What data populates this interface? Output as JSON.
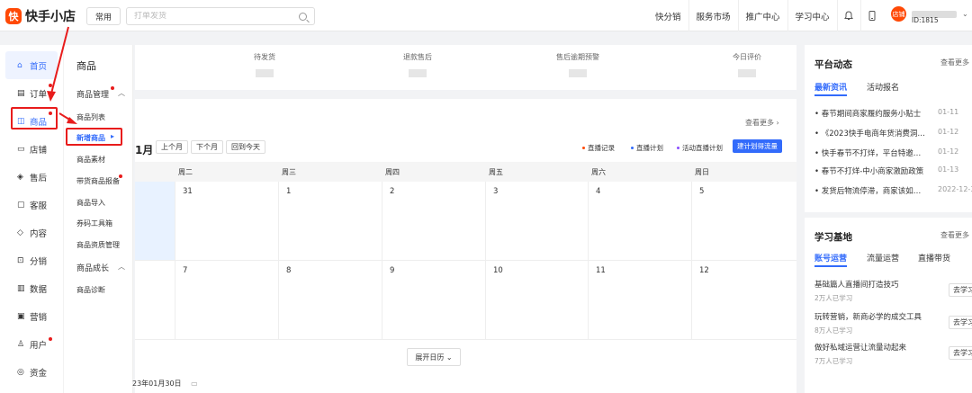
{
  "header": {
    "logo_mark": "快",
    "logo_text": "快手小店",
    "common_btn": "常用",
    "search_placeholder": "打单发货",
    "nav": [
      "快分销",
      "服务市场",
      "推广中心",
      "学习中心"
    ],
    "bell_icon": "bell-icon",
    "phone_icon": "phone-icon",
    "avatar_text": "店铺",
    "user_id": "ID:1815"
  },
  "left_nav": {
    "items": [
      {
        "label": "首页",
        "icon": "home-icon",
        "glyph": "⌂"
      },
      {
        "label": "订单",
        "icon": "order-icon",
        "glyph": "▤"
      },
      {
        "label": "商品",
        "icon": "product-icon",
        "glyph": "◫"
      },
      {
        "label": "店铺",
        "icon": "shop-icon",
        "glyph": "▭"
      },
      {
        "label": "售后",
        "icon": "aftersale-icon",
        "glyph": "◈"
      },
      {
        "label": "客服",
        "icon": "service-icon",
        "glyph": "▢"
      },
      {
        "label": "内容",
        "icon": "content-icon",
        "glyph": "◇"
      },
      {
        "label": "分销",
        "icon": "distribution-icon",
        "glyph": "⊡"
      },
      {
        "label": "数据",
        "icon": "data-icon",
        "glyph": "▥"
      },
      {
        "label": "营销",
        "icon": "marketing-icon",
        "glyph": "▣"
      },
      {
        "label": "用户",
        "icon": "user-icon",
        "glyph": "♙"
      },
      {
        "label": "资金",
        "icon": "fund-icon",
        "glyph": "◎"
      }
    ]
  },
  "sub_nav": {
    "title": "商品",
    "group1": "商品管理",
    "items1": [
      "商品列表",
      "新增商品",
      "商品素材",
      "带货商品报备",
      "商品导入",
      "券码工具箱",
      "商品资质管理"
    ],
    "group2": "商品成长",
    "items2": [
      "商品诊断"
    ]
  },
  "stats": [
    "待发货",
    "退款售后",
    "售后逾期预警",
    "今日评价"
  ],
  "calendar": {
    "more": "查看更多",
    "month_suffix": "1月",
    "prev": "上个月",
    "next": "下个月",
    "today": "回到今天",
    "legend": [
      {
        "label": "直播记录",
        "color": "#ff4906"
      },
      {
        "label": "直播计划",
        "color": "#326bfb"
      },
      {
        "label": "活动直播计划",
        "color": "#8a4dff"
      }
    ],
    "primary": "建计划得流量",
    "weekdays": [
      "周二",
      "周三",
      "周四",
      "周五",
      "周六",
      "周日"
    ],
    "row1": [
      "31",
      "1",
      "2",
      "3",
      "4",
      "5"
    ],
    "row2": [
      "7",
      "8",
      "9",
      "10",
      "11",
      "12"
    ],
    "expand": "展开日历",
    "bottom_date": "23年01月30日"
  },
  "platform": {
    "title": "平台动态",
    "more": "查看更多",
    "tabs": [
      "最新资讯",
      "活动报名"
    ],
    "news": [
      {
        "title": "春节期间商家履约服务小贴士",
        "date": "01-11"
      },
      {
        "title": "《2023快手电商年货消费洞…",
        "date": "01-12"
      },
      {
        "title": "快手春节不打烊，平台特邀…",
        "date": "01-12"
      },
      {
        "title": "春节不打烊-中小商家激励政策",
        "date": "01-13"
      },
      {
        "title": "发货后物流停滞，商家该如…",
        "date": "2022-12-30"
      }
    ]
  },
  "learning": {
    "title": "学习基地",
    "more": "查看更多",
    "tabs": [
      "账号运营",
      "流量运营",
      "直播带货"
    ],
    "items": [
      {
        "title": "基础篇人直播间打造技巧",
        "sub": "2万人已学习",
        "btn": "去学习"
      },
      {
        "title": "玩转营销，新商必学的成交工具",
        "sub": "8万人已学习",
        "btn": "去学习"
      },
      {
        "title": "做好私域运营让流量动起来",
        "sub": "7万人已学习",
        "btn": "去学习"
      }
    ]
  }
}
